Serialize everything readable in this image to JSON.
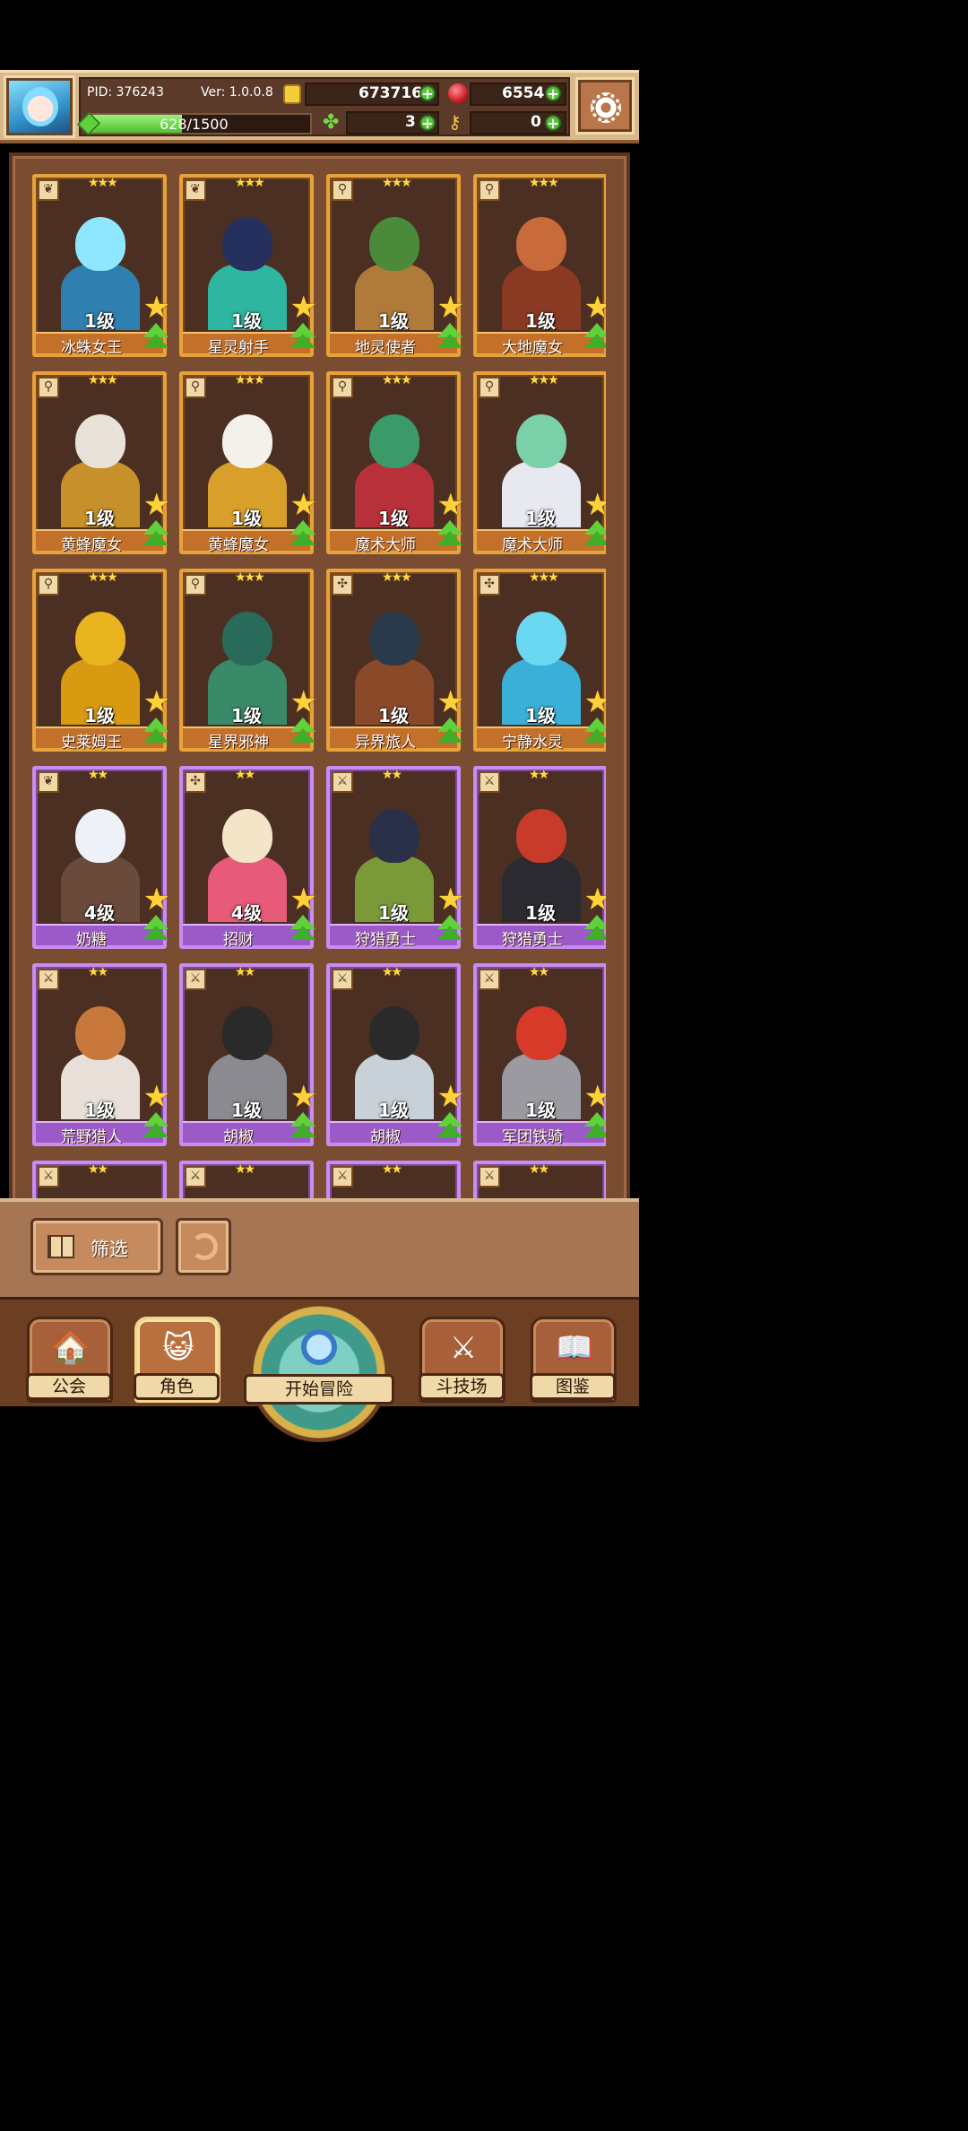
{
  "header": {
    "pid_label": "PID: 376243",
    "version_label": "Ver: 1.0.0.8",
    "gold": "673716",
    "ruby": "6554",
    "xp_text": "628/1500",
    "xp_progress": 0.4187,
    "clover": "3",
    "keys": "0"
  },
  "roster": {
    "cards": [
      {
        "name": "冰蛛女王",
        "level": "1级",
        "stars": "★★★",
        "rarity": "gold",
        "icon": "leaf-icon",
        "head": "#8fe7ff",
        "body": "#2f7fb0"
      },
      {
        "name": "星灵射手",
        "level": "1级",
        "stars": "★★★",
        "rarity": "gold",
        "icon": "leaf-icon",
        "head": "#25305e",
        "body": "#2fb6a0"
      },
      {
        "name": "地灵使者",
        "level": "1级",
        "stars": "★★★",
        "rarity": "gold",
        "icon": "wand-icon",
        "head": "#4a8a3a",
        "body": "#b07a3a"
      },
      {
        "name": "大地魔女",
        "level": "1级",
        "stars": "★★★",
        "rarity": "gold",
        "icon": "wand-icon",
        "head": "#c86a3a",
        "body": "#8a3a22"
      },
      {
        "name": "黄蜂魔女",
        "level": "1级",
        "stars": "★★★",
        "rarity": "gold",
        "icon": "wand-icon",
        "head": "#e8e2d8",
        "body": "#c8902a"
      },
      {
        "name": "黄蜂魔女",
        "level": "1级",
        "stars": "★★★",
        "rarity": "gold",
        "icon": "wand-icon",
        "head": "#f4f0ea",
        "body": "#d8a02a"
      },
      {
        "name": "魔术大师",
        "level": "1级",
        "stars": "★★★",
        "rarity": "gold",
        "icon": "wand-icon",
        "head": "#3a9a6a",
        "body": "#b8303a"
      },
      {
        "name": "魔术大师",
        "level": "1级",
        "stars": "★★★",
        "rarity": "gold",
        "icon": "wand-icon",
        "head": "#7ad0a8",
        "body": "#e8e8f0"
      },
      {
        "name": "史莱姆王",
        "level": "1级",
        "stars": "★★★",
        "rarity": "gold",
        "icon": "wand-icon",
        "head": "#e8b420",
        "body": "#d89a10"
      },
      {
        "name": "星界邪神",
        "level": "1级",
        "stars": "★★★",
        "rarity": "gold",
        "icon": "wand-icon",
        "head": "#2a6a5a",
        "body": "#3a8a6a"
      },
      {
        "name": "异界旅人",
        "level": "1级",
        "stars": "★★★",
        "rarity": "gold",
        "icon": "cross-icon",
        "head": "#2a3a4a",
        "body": "#8a4a2a"
      },
      {
        "name": "宁静水灵",
        "level": "1级",
        "stars": "★★★",
        "rarity": "gold",
        "icon": "cross-icon",
        "head": "#6ad8f0",
        "body": "#3ab0d8"
      },
      {
        "name": "奶糖",
        "level": "4级",
        "stars": "★★",
        "rarity": "purple",
        "icon": "leaf-icon",
        "head": "#eef2f8",
        "body": "#6a4a3a"
      },
      {
        "name": "招财",
        "level": "4级",
        "stars": "★★",
        "rarity": "purple",
        "icon": "cross-icon",
        "head": "#f4e4c8",
        "body": "#e85a7a"
      },
      {
        "name": "狩猎勇士",
        "level": "1级",
        "stars": "★★",
        "rarity": "purple",
        "icon": "sword-icon",
        "head": "#2a3048",
        "body": "#7a9a3a"
      },
      {
        "name": "狩猎勇士",
        "level": "1级",
        "stars": "★★",
        "rarity": "purple",
        "icon": "sword-icon",
        "head": "#c83a2a",
        "body": "#2a2a30"
      },
      {
        "name": "荒野猎人",
        "level": "1级",
        "stars": "★★",
        "rarity": "purple",
        "icon": "sword-icon",
        "head": "#c8783a",
        "body": "#e8e0d8"
      },
      {
        "name": "胡椒",
        "level": "1级",
        "stars": "★★",
        "rarity": "purple",
        "icon": "sword-icon",
        "head": "#2a2a2a",
        "body": "#8a8a90"
      },
      {
        "name": "胡椒",
        "level": "1级",
        "stars": "★★",
        "rarity": "purple",
        "icon": "sword-icon",
        "head": "#2a2a2a",
        "body": "#c8d0d8"
      },
      {
        "name": "军团铁骑",
        "level": "1级",
        "stars": "★★",
        "rarity": "purple",
        "icon": "sword-icon",
        "head": "#d83a2a",
        "body": "#9a9aa0"
      },
      {
        "name": "",
        "level": "",
        "stars": "★★",
        "rarity": "purple",
        "icon": "sword-icon",
        "head": "#3a3a48",
        "body": "#4a4a58"
      },
      {
        "name": "",
        "level": "",
        "stars": "★★",
        "rarity": "purple",
        "icon": "sword-icon",
        "head": "#c8602a",
        "body": "#8a4a2a"
      },
      {
        "name": "",
        "level": "",
        "stars": "★★",
        "rarity": "purple",
        "icon": "sword-icon",
        "head": "#eef2f8",
        "body": "#d8e0e8"
      },
      {
        "name": "",
        "level": "",
        "stars": "★★",
        "rarity": "purple",
        "icon": "sword-icon",
        "head": "#6ad8f0",
        "body": "#3ab0d8"
      }
    ]
  },
  "toolbar": {
    "filter_label": "筛选"
  },
  "nav": {
    "guild": "公会",
    "character": "角色",
    "adventure": "开始冒险",
    "arena": "斗技场",
    "codex": "图鉴"
  }
}
